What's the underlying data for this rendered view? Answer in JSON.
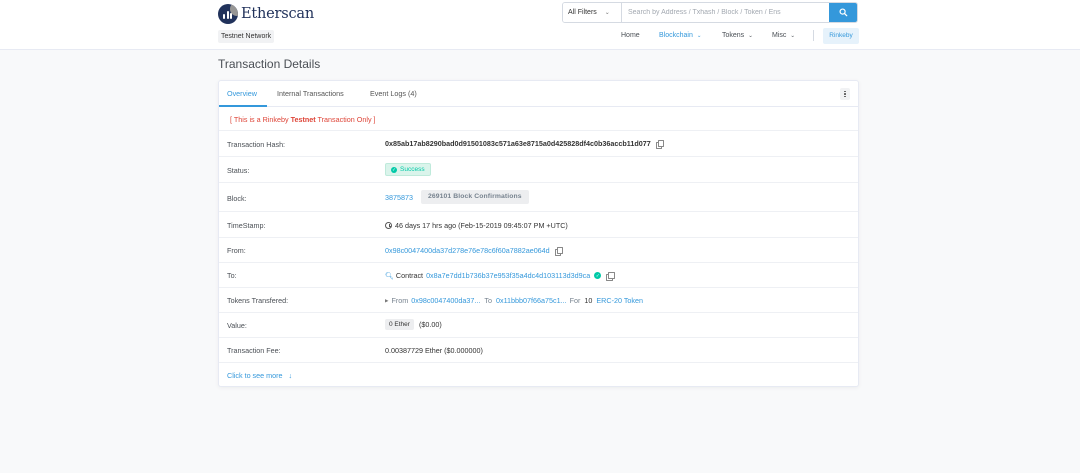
{
  "header": {
    "logo_text": "Etherscan",
    "network_badge": "Testnet Network",
    "search": {
      "filter_label": "All Filters",
      "placeholder": "Search by Address / Txhash / Block / Token / Ens"
    },
    "nav": {
      "home": "Home",
      "blockchain": "Blockchain",
      "tokens": "Tokens",
      "misc": "Misc",
      "network": "Rinkeby"
    }
  },
  "page_title": "Transaction Details",
  "tabs": {
    "overview": "Overview",
    "internal": "Internal Transactions",
    "logs": "Event Logs (4)"
  },
  "details": {
    "testnet_note_prefix": "[ This is a Rinkeby ",
    "testnet_note_bold": "Testnet",
    "testnet_note_suffix": " Transaction Only ]",
    "hash_label": "Transaction Hash:",
    "hash_value": "0x85ab17ab8290bad0d91501083c571a63e8715a0d425828df4c0b36accb11d077",
    "status_label": "Status:",
    "status_value": "Success",
    "block_label": "Block:",
    "block_value": "3875873",
    "block_confirmations": "269101 Block Confirmations",
    "timestamp_label": "TimeStamp:",
    "timestamp_value": "46 days 17 hrs ago (Feb-15-2019 09:45:07 PM +UTC)",
    "from_label": "From:",
    "from_value": "0x98c0047400da37d278e76e78c6f60a7882ae064d",
    "to_label": "To:",
    "to_prefix": "Contract",
    "to_value": "0x8a7e7dd1b736b37e953f35a4dc4d103113d3d9ca",
    "tokens_label": "Tokens Transfered:",
    "tokens_from_label": "From",
    "tokens_from_value": "0x98c0047400da37...",
    "tokens_to_label": "To",
    "tokens_to_value": "0x11bbb07f66a75c1...",
    "tokens_for_label": "For",
    "tokens_amount": "10",
    "tokens_name": "ERC-20 Token",
    "value_label": "Value:",
    "value_ether": "0 Ether",
    "value_usd": "($0.00)",
    "fee_label": "Transaction Fee:",
    "fee_value": "0.00387729 Ether ($0.000000)",
    "see_more": "Click to see more"
  }
}
